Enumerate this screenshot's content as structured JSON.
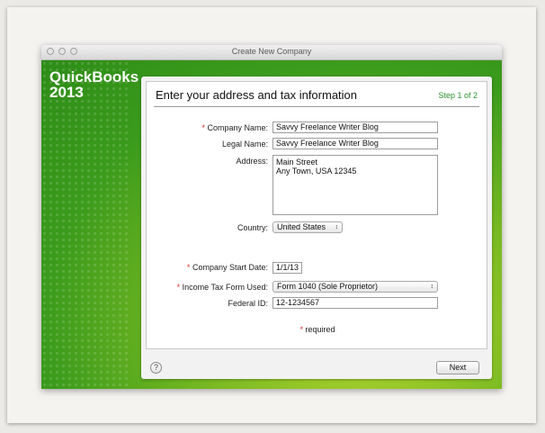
{
  "window": {
    "title": "Create New Company"
  },
  "brand": {
    "line1": "QuickBooks",
    "line2": "2013"
  },
  "header": {
    "title": "Enter your address and tax information",
    "step": "Step 1 of 2"
  },
  "form": {
    "required_mark": "*",
    "company_name": {
      "label": "Company Name:",
      "value": "Savvy Freelance Writer Blog"
    },
    "legal_name": {
      "label": "Legal Name:",
      "value": "Savvy Freelance Writer Blog"
    },
    "address": {
      "label": "Address:",
      "line1": "Main Street",
      "line2": "Any Town, USA 12345"
    },
    "country": {
      "label": "Country:",
      "value": "United States"
    },
    "start_date": {
      "label": "Company Start Date:",
      "value": "1/1/13"
    },
    "tax_form": {
      "label": "Income Tax Form Used:",
      "value": "Form 1040 (Sole Proprietor)"
    },
    "federal_id": {
      "label": "Federal ID:",
      "value": "12-1234567"
    },
    "required_note": "required"
  },
  "footer": {
    "help": "?",
    "next_label": "Next"
  },
  "colors": {
    "brand_green": "#3b9b1c",
    "step_green": "#2a8f2e",
    "required_red": "#e0302b"
  }
}
